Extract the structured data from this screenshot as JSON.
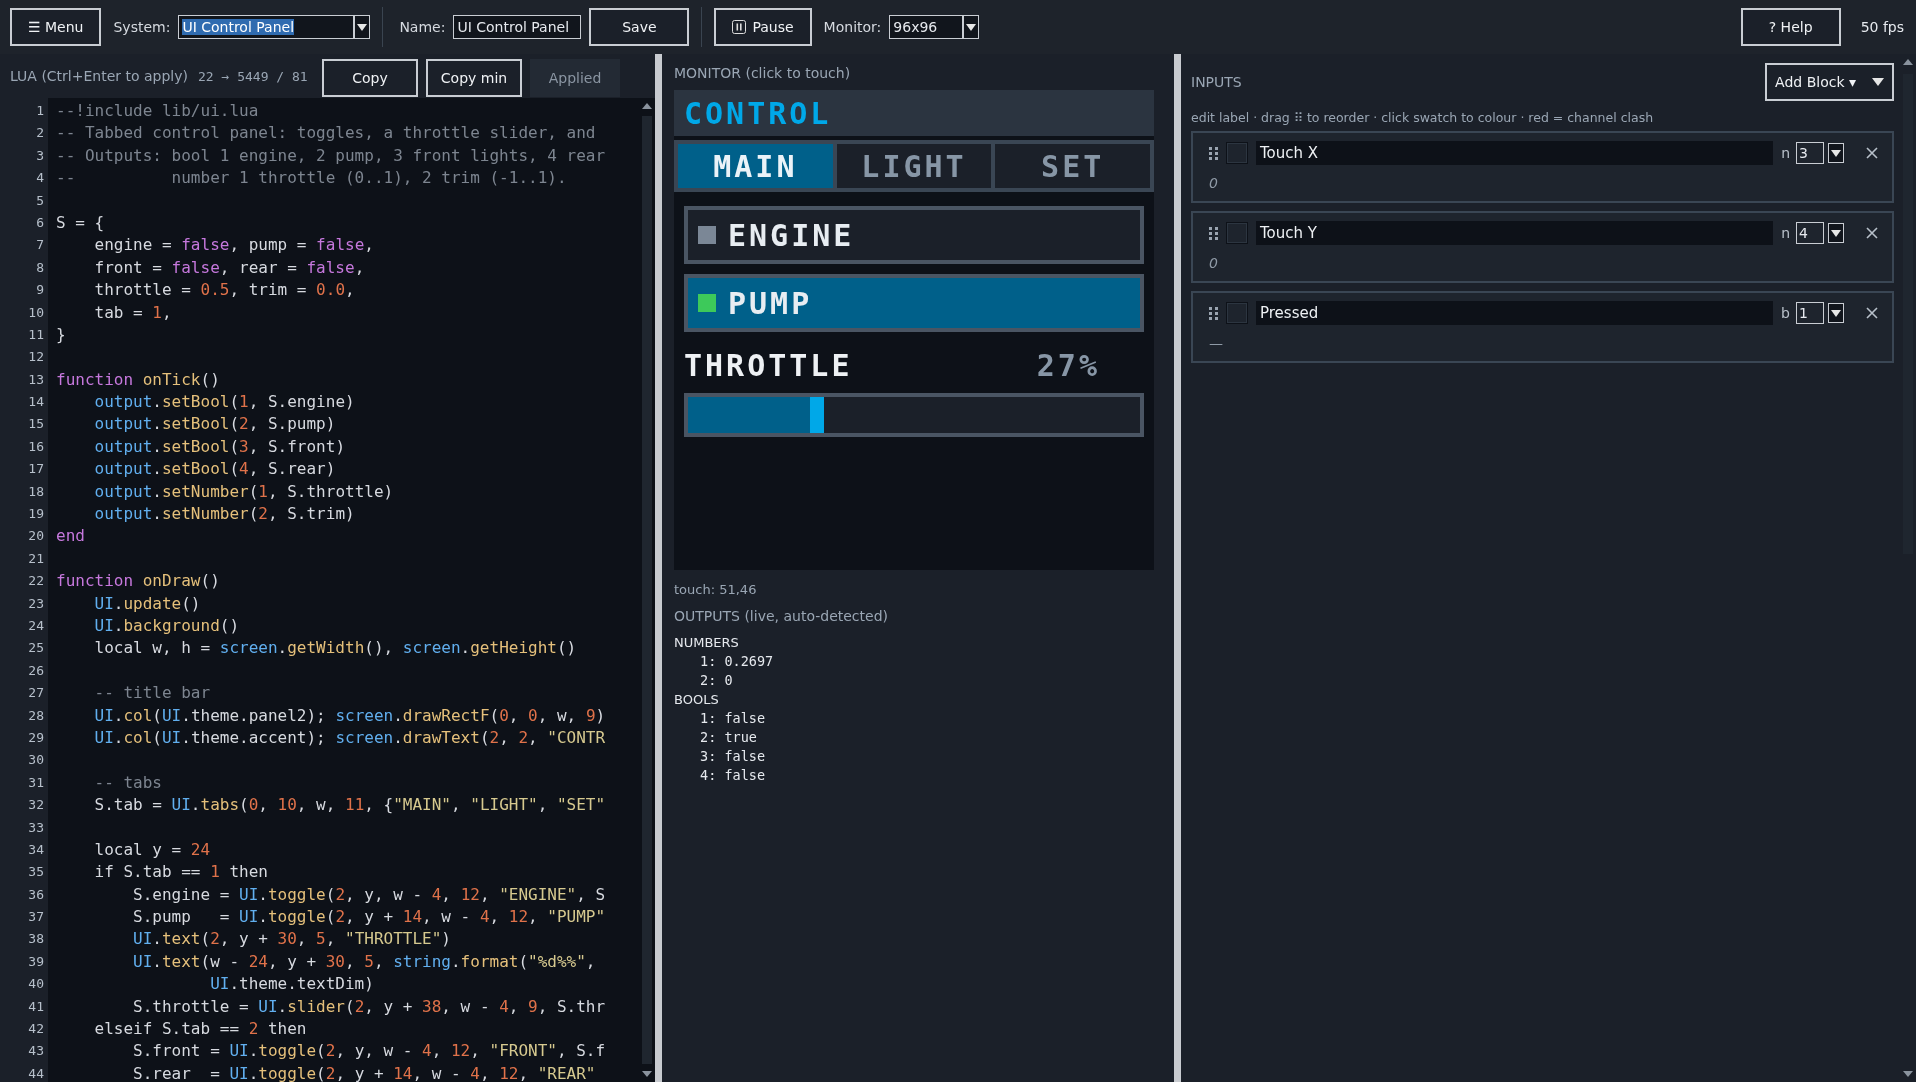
{
  "toolbar": {
    "menu": "☰ Menu",
    "system": {
      "label": "System:",
      "value": "UI Control Panel"
    },
    "name": {
      "label": "Name:",
      "value": "UI Control Panel"
    },
    "save": "Save",
    "pause": "Pause",
    "monitor": {
      "label": "Monitor:",
      "value": "96x96"
    },
    "help": "? Help",
    "fps": "50 fps"
  },
  "editor": {
    "title": "LUA  (Ctrl+Enter to apply)",
    "size": "22 → 5449 / 81",
    "buttons": [
      {
        "label": "Copy",
        "disabled": false
      },
      {
        "label": "Copy min",
        "disabled": false
      },
      {
        "label": "Applied",
        "disabled": true
      }
    ],
    "lines": [
      {
        "n": "1",
        "tokens": [
          {
            "kind": "comment",
            "text": "--!include lib/ui.lua"
          }
        ]
      },
      {
        "n": "2",
        "tokens": [
          {
            "kind": "comment",
            "text": "-- Tabbed control panel: toggles, a throttle slider, and"
          }
        ]
      },
      {
        "n": "3",
        "tokens": [
          {
            "kind": "comment",
            "text": "-- Outputs: bool 1 engine, 2 pump, 3 front lights, 4 rear"
          }
        ]
      },
      {
        "n": "4",
        "tokens": [
          {
            "kind": "comment",
            "text": "--          number 1 throttle (0..1), 2 trim (-1..1)."
          }
        ]
      },
      {
        "n": "5"
      },
      {
        "n": "6",
        "tokens": [
          {
            "kind": "plain",
            "text": "S = {"
          }
        ]
      },
      {
        "n": "7",
        "tokens": [
          {
            "kind": "plain",
            "text": "    engine = "
          },
          {
            "kind": "keyword",
            "text": "false"
          },
          {
            "kind": "plain",
            "text": ", pump = "
          },
          {
            "kind": "keyword",
            "text": "false"
          },
          {
            "kind": "plain",
            "text": ","
          }
        ]
      },
      {
        "n": "8",
        "tokens": [
          {
            "kind": "plain",
            "text": "    front = "
          },
          {
            "kind": "keyword",
            "text": "false"
          },
          {
            "kind": "plain",
            "text": ", rear = "
          },
          {
            "kind": "keyword",
            "text": "false"
          },
          {
            "kind": "plain",
            "text": ","
          }
        ]
      },
      {
        "n": "9",
        "tokens": [
          {
            "kind": "plain",
            "text": "    throttle = "
          },
          {
            "kind": "number",
            "text": "0.5"
          },
          {
            "kind": "plain",
            "text": ", trim = "
          },
          {
            "kind": "number",
            "text": "0.0"
          },
          {
            "kind": "plain",
            "text": ","
          }
        ]
      },
      {
        "n": "10",
        "tokens": [
          {
            "kind": "plain",
            "text": "    tab = "
          },
          {
            "kind": "number",
            "text": "1"
          },
          {
            "kind": "plain",
            "text": ","
          }
        ]
      },
      {
        "n": "11",
        "tokens": [
          {
            "kind": "plain",
            "text": "}"
          }
        ]
      },
      {
        "n": "12"
      },
      {
        "n": "13",
        "tokens": [
          {
            "kind": "keyword",
            "text": "function "
          },
          {
            "kind": "function",
            "text": "onTick"
          },
          {
            "kind": "plain",
            "text": "()"
          }
        ]
      },
      {
        "n": "14",
        "tokens": [
          {
            "kind": "object",
            "text": "    output"
          },
          {
            "kind": "plain",
            "text": "."
          },
          {
            "kind": "function",
            "text": "setBool"
          },
          {
            "kind": "plain",
            "text": "("
          },
          {
            "kind": "number",
            "text": "1"
          },
          {
            "kind": "plain",
            "text": ", S.engine)"
          }
        ]
      },
      {
        "n": "15",
        "tokens": [
          {
            "kind": "object",
            "text": "    output"
          },
          {
            "kind": "plain",
            "text": "."
          },
          {
            "kind": "function",
            "text": "setBool"
          },
          {
            "kind": "plain",
            "text": "("
          },
          {
            "kind": "number",
            "text": "2"
          },
          {
            "kind": "plain",
            "text": ", S.pump)"
          }
        ]
      },
      {
        "n": "16",
        "tokens": [
          {
            "kind": "object",
            "text": "    output"
          },
          {
            "kind": "plain",
            "text": "."
          },
          {
            "kind": "function",
            "text": "setBool"
          },
          {
            "kind": "plain",
            "text": "("
          },
          {
            "kind": "number",
            "text": "3"
          },
          {
            "kind": "plain",
            "text": ", S.front)"
          }
        ]
      },
      {
        "n": "17",
        "tokens": [
          {
            "kind": "object",
            "text": "    output"
          },
          {
            "kind": "plain",
            "text": "."
          },
          {
            "kind": "function",
            "text": "setBool"
          },
          {
            "kind": "plain",
            "text": "("
          },
          {
            "kind": "number",
            "text": "4"
          },
          {
            "kind": "plain",
            "text": ", S.rear)"
          }
        ]
      },
      {
        "n": "18",
        "tokens": [
          {
            "kind": "object",
            "text": "    output"
          },
          {
            "kind": "plain",
            "text": "."
          },
          {
            "kind": "function",
            "text": "setNumber"
          },
          {
            "kind": "plain",
            "text": "("
          },
          {
            "kind": "number",
            "text": "1"
          },
          {
            "kind": "plain",
            "text": ", S.throttle)"
          }
        ]
      },
      {
        "n": "19",
        "tokens": [
          {
            "kind": "object",
            "text": "    output"
          },
          {
            "kind": "plain",
            "text": "."
          },
          {
            "kind": "function",
            "text": "setNumber"
          },
          {
            "kind": "plain",
            "text": "("
          },
          {
            "kind": "number",
            "text": "2"
          },
          {
            "kind": "plain",
            "text": ", S.trim)"
          }
        ]
      },
      {
        "n": "20",
        "tokens": [
          {
            "kind": "keyword",
            "text": "end"
          }
        ]
      },
      {
        "n": "21"
      },
      {
        "n": "22",
        "tokens": [
          {
            "kind": "keyword",
            "text": "function "
          },
          {
            "kind": "function",
            "text": "onDraw"
          },
          {
            "kind": "plain",
            "text": "()"
          }
        ]
      },
      {
        "n": "23",
        "tokens": [
          {
            "kind": "object",
            "text": "    UI"
          },
          {
            "kind": "plain",
            "text": "."
          },
          {
            "kind": "function",
            "text": "update"
          },
          {
            "kind": "plain",
            "text": "()"
          }
        ]
      },
      {
        "n": "24",
        "tokens": [
          {
            "kind": "object",
            "text": "    UI"
          },
          {
            "kind": "plain",
            "text": "."
          },
          {
            "kind": "function",
            "text": "background"
          },
          {
            "kind": "plain",
            "text": "()"
          }
        ]
      },
      {
        "n": "25",
        "tokens": [
          {
            "kind": "plain",
            "text": "    local w, h = "
          },
          {
            "kind": "object",
            "text": "screen"
          },
          {
            "kind": "plain",
            "text": "."
          },
          {
            "kind": "function",
            "text": "getWidth"
          },
          {
            "kind": "plain",
            "text": "(), "
          },
          {
            "kind": "object",
            "text": "screen"
          },
          {
            "kind": "plain",
            "text": "."
          },
          {
            "kind": "function",
            "text": "getHeight"
          },
          {
            "kind": "plain",
            "text": "()"
          }
        ]
      },
      {
        "n": "26"
      },
      {
        "n": "27",
        "tokens": [
          {
            "kind": "comment",
            "text": "    -- title bar"
          }
        ]
      },
      {
        "n": "28",
        "tokens": [
          {
            "kind": "object",
            "text": "    UI"
          },
          {
            "kind": "plain",
            "text": "."
          },
          {
            "kind": "function",
            "text": "col"
          },
          {
            "kind": "plain",
            "text": "("
          },
          {
            "kind": "object",
            "text": "UI"
          },
          {
            "kind": "plain",
            "text": ".theme.panel2); "
          },
          {
            "kind": "object",
            "text": "screen"
          },
          {
            "kind": "plain",
            "text": "."
          },
          {
            "kind": "function",
            "text": "drawRectF"
          },
          {
            "kind": "plain",
            "text": "("
          },
          {
            "kind": "number",
            "text": "0"
          },
          {
            "kind": "plain",
            "text": ", "
          },
          {
            "kind": "number",
            "text": "0"
          },
          {
            "kind": "plain",
            "text": ", w, "
          },
          {
            "kind": "number",
            "text": "9"
          },
          {
            "kind": "plain",
            "text": ")"
          }
        ]
      },
      {
        "n": "29",
        "tokens": [
          {
            "kind": "object",
            "text": "    UI"
          },
          {
            "kind": "plain",
            "text": "."
          },
          {
            "kind": "function",
            "text": "col"
          },
          {
            "kind": "plain",
            "text": "("
          },
          {
            "kind": "object",
            "text": "UI"
          },
          {
            "kind": "plain",
            "text": ".theme.accent); "
          },
          {
            "kind": "object",
            "text": "screen"
          },
          {
            "kind": "plain",
            "text": "."
          },
          {
            "kind": "function",
            "text": "drawText"
          },
          {
            "kind": "plain",
            "text": "("
          },
          {
            "kind": "number",
            "text": "2"
          },
          {
            "kind": "plain",
            "text": ", "
          },
          {
            "kind": "number",
            "text": "2"
          },
          {
            "kind": "plain",
            "text": ", "
          },
          {
            "kind": "string",
            "text": "\"CONTR"
          }
        ]
      },
      {
        "n": "30"
      },
      {
        "n": "31",
        "tokens": [
          {
            "kind": "comment",
            "text": "    -- tabs"
          }
        ]
      },
      {
        "n": "32",
        "tokens": [
          {
            "kind": "plain",
            "text": "    S.tab = "
          },
          {
            "kind": "object",
            "text": "UI"
          },
          {
            "kind": "plain",
            "text": "."
          },
          {
            "kind": "function",
            "text": "tabs"
          },
          {
            "kind": "plain",
            "text": "("
          },
          {
            "kind": "number",
            "text": "0"
          },
          {
            "kind": "plain",
            "text": ", "
          },
          {
            "kind": "number",
            "text": "10"
          },
          {
            "kind": "plain",
            "text": ", w, "
          },
          {
            "kind": "number",
            "text": "11"
          },
          {
            "kind": "plain",
            "text": ", {"
          },
          {
            "kind": "string",
            "text": "\"MAIN\""
          },
          {
            "kind": "plain",
            "text": ", "
          },
          {
            "kind": "string",
            "text": "\"LIGHT\""
          },
          {
            "kind": "plain",
            "text": ", "
          },
          {
            "kind": "string",
            "text": "\"SET\""
          }
        ]
      },
      {
        "n": "33"
      },
      {
        "n": "34",
        "tokens": [
          {
            "kind": "plain",
            "text": "    local y = "
          },
          {
            "kind": "number",
            "text": "24"
          }
        ]
      },
      {
        "n": "35",
        "tokens": [
          {
            "kind": "plain",
            "text": "    if S.tab == "
          },
          {
            "kind": "number",
            "text": "1"
          },
          {
            "kind": "plain",
            "text": " then"
          }
        ]
      },
      {
        "n": "36",
        "tokens": [
          {
            "kind": "plain",
            "text": "        S.engine = "
          },
          {
            "kind": "object",
            "text": "UI"
          },
          {
            "kind": "plain",
            "text": "."
          },
          {
            "kind": "function",
            "text": "toggle"
          },
          {
            "kind": "plain",
            "text": "("
          },
          {
            "kind": "number",
            "text": "2"
          },
          {
            "kind": "plain",
            "text": ", y, w - "
          },
          {
            "kind": "number",
            "text": "4"
          },
          {
            "kind": "plain",
            "text": ", "
          },
          {
            "kind": "number",
            "text": "12"
          },
          {
            "kind": "plain",
            "text": ", "
          },
          {
            "kind": "string",
            "text": "\"ENGINE\""
          },
          {
            "kind": "plain",
            "text": ", S"
          }
        ]
      },
      {
        "n": "37",
        "tokens": [
          {
            "kind": "plain",
            "text": "        S.pump   = "
          },
          {
            "kind": "object",
            "text": "UI"
          },
          {
            "kind": "plain",
            "text": "."
          },
          {
            "kind": "function",
            "text": "toggle"
          },
          {
            "kind": "plain",
            "text": "("
          },
          {
            "kind": "number",
            "text": "2"
          },
          {
            "kind": "plain",
            "text": ", y + "
          },
          {
            "kind": "number",
            "text": "14"
          },
          {
            "kind": "plain",
            "text": ", w - "
          },
          {
            "kind": "number",
            "text": "4"
          },
          {
            "kind": "plain",
            "text": ", "
          },
          {
            "kind": "number",
            "text": "12"
          },
          {
            "kind": "plain",
            "text": ", "
          },
          {
            "kind": "string",
            "text": "\"PUMP\""
          }
        ]
      },
      {
        "n": "38",
        "tokens": [
          {
            "kind": "object",
            "text": "        UI"
          },
          {
            "kind": "plain",
            "text": "."
          },
          {
            "kind": "function",
            "text": "text"
          },
          {
            "kind": "plain",
            "text": "("
          },
          {
            "kind": "number",
            "text": "2"
          },
          {
            "kind": "plain",
            "text": ", y + "
          },
          {
            "kind": "number",
            "text": "30"
          },
          {
            "kind": "plain",
            "text": ", "
          },
          {
            "kind": "number",
            "text": "5"
          },
          {
            "kind": "plain",
            "text": ", "
          },
          {
            "kind": "string",
            "text": "\"THROTTLE\""
          },
          {
            "kind": "plain",
            "text": ")"
          }
        ]
      },
      {
        "n": "39",
        "tokens": [
          {
            "kind": "object",
            "text": "        UI"
          },
          {
            "kind": "plain",
            "text": "."
          },
          {
            "kind": "function",
            "text": "text"
          },
          {
            "kind": "plain",
            "text": "(w - "
          },
          {
            "kind": "number",
            "text": "24"
          },
          {
            "kind": "plain",
            "text": ", y + "
          },
          {
            "kind": "number",
            "text": "30"
          },
          {
            "kind": "plain",
            "text": ", "
          },
          {
            "kind": "number",
            "text": "5"
          },
          {
            "kind": "plain",
            "text": ", "
          },
          {
            "kind": "object",
            "text": "string"
          },
          {
            "kind": "plain",
            "text": "."
          },
          {
            "kind": "function",
            "text": "format"
          },
          {
            "kind": "plain",
            "text": "("
          },
          {
            "kind": "string",
            "text": "\"%d%%\""
          },
          {
            "kind": "plain",
            "text": ","
          }
        ]
      },
      {
        "n": "40",
        "tokens": [
          {
            "kind": "object",
            "text": "                UI"
          },
          {
            "kind": "plain",
            "text": ".theme.textDim)"
          }
        ]
      },
      {
        "n": "41",
        "tokens": [
          {
            "kind": "plain",
            "text": "        S.throttle = "
          },
          {
            "kind": "object",
            "text": "UI"
          },
          {
            "kind": "plain",
            "text": "."
          },
          {
            "kind": "function",
            "text": "slider"
          },
          {
            "kind": "plain",
            "text": "("
          },
          {
            "kind": "number",
            "text": "2"
          },
          {
            "kind": "plain",
            "text": ", y + "
          },
          {
            "kind": "number",
            "text": "38"
          },
          {
            "kind": "plain",
            "text": ", w - "
          },
          {
            "kind": "number",
            "text": "4"
          },
          {
            "kind": "plain",
            "text": ", "
          },
          {
            "kind": "number",
            "text": "9"
          },
          {
            "kind": "plain",
            "text": ", S.thr"
          }
        ]
      },
      {
        "n": "42",
        "tokens": [
          {
            "kind": "plain",
            "text": "    elseif S.tab == "
          },
          {
            "kind": "number",
            "text": "2"
          },
          {
            "kind": "plain",
            "text": " then"
          }
        ]
      },
      {
        "n": "43",
        "tokens": [
          {
            "kind": "plain",
            "text": "        S.front = "
          },
          {
            "kind": "object",
            "text": "UI"
          },
          {
            "kind": "plain",
            "text": "."
          },
          {
            "kind": "function",
            "text": "toggle"
          },
          {
            "kind": "plain",
            "text": "("
          },
          {
            "kind": "number",
            "text": "2"
          },
          {
            "kind": "plain",
            "text": ", y, w - "
          },
          {
            "kind": "number",
            "text": "4"
          },
          {
            "kind": "plain",
            "text": ", "
          },
          {
            "kind": "number",
            "text": "12"
          },
          {
            "kind": "plain",
            "text": ", "
          },
          {
            "kind": "string",
            "text": "\"FRONT\""
          },
          {
            "kind": "plain",
            "text": ", S.f"
          }
        ]
      },
      {
        "n": "44",
        "tokens": [
          {
            "kind": "plain",
            "text": "        S.rear  = "
          },
          {
            "kind": "object",
            "text": "UI"
          },
          {
            "kind": "plain",
            "text": "."
          },
          {
            "kind": "function",
            "text": "toggle"
          },
          {
            "kind": "plain",
            "text": "("
          },
          {
            "kind": "number",
            "text": "2"
          },
          {
            "kind": "plain",
            "text": ", y + "
          },
          {
            "kind": "number",
            "text": "14"
          },
          {
            "kind": "plain",
            "text": ", w - "
          },
          {
            "kind": "number",
            "text": "4"
          },
          {
            "kind": "plain",
            "text": ", "
          },
          {
            "kind": "number",
            "text": "12"
          },
          {
            "kind": "plain",
            "text": ", "
          },
          {
            "kind": "string",
            "text": "\"REAR\""
          }
        ]
      }
    ]
  },
  "monitor": {
    "title": "MONITOR  (click to touch)",
    "screen_title": "CONTROL",
    "tabs": [
      {
        "label": "MAIN",
        "selected": true
      },
      {
        "label": "LIGHT",
        "selected": false
      },
      {
        "label": "SET",
        "selected": false
      }
    ],
    "toggles": [
      {
        "label": "ENGINE",
        "on": false
      },
      {
        "label": "PUMP",
        "on": true
      }
    ],
    "slider": {
      "label": "THROTTLE",
      "reading": "27%",
      "level": 0.27
    },
    "touch": "touch: 51,46"
  },
  "outputs": {
    "title": "OUTPUTS  (live, auto-detected)",
    "groups": [
      {
        "label": "NUMBERS",
        "items": [
          "1: 0.2697",
          "2: 0"
        ]
      },
      {
        "label": "BOOLS",
        "items": [
          "1: false",
          "2: true",
          "3: false",
          "4: false"
        ]
      }
    ]
  },
  "inputs": {
    "title": "INPUTS",
    "add_button": "Add Block ▾",
    "hint": "edit label · drag ⠿ to reorder · click swatch to colour · red = channel clash",
    "blocks": [
      {
        "label": "Touch X",
        "type": "n",
        "channel": "3",
        "value": "0"
      },
      {
        "label": "Touch Y",
        "type": "n",
        "channel": "4",
        "value": "0"
      },
      {
        "label": "Pressed",
        "type": "b",
        "channel": "1",
        "value": "—"
      }
    ]
  }
}
